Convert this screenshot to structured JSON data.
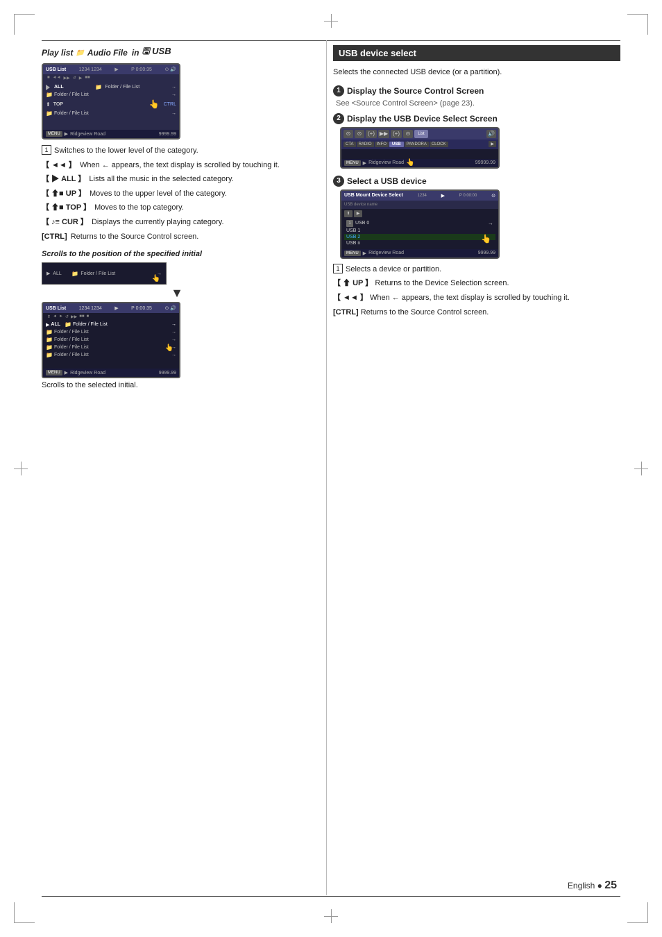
{
  "page": {
    "number": "25",
    "language": "English"
  },
  "left_column": {
    "playlist_header": "Play list",
    "icon_music": "♪",
    "icon_folder": "📁",
    "location": "Audio File in USB",
    "screen1": {
      "topbar_left": "USB List",
      "topbar_right": "1234 1234",
      "topbar_time": "P 0:00:35",
      "row1": "ALL",
      "row2": "Folder / File List",
      "row3": "Folder / File List",
      "row4": "TOP",
      "row5": "Folder / File List",
      "bottombar": "MENU  ▶  Ridgeview Road  9999.99"
    },
    "desc_items": [
      {
        "num": "1",
        "text": "Switches to the lower level of the category."
      },
      {
        "bracket": "[ ◄◄ ]",
        "text": "When ← appears, the text display is scrolled by touching it."
      },
      {
        "bracket": "[ ▶ ALL ]",
        "text": "Lists all the music in the selected category."
      },
      {
        "bracket": "[ ⬆■ UP ]",
        "text": "Moves to the upper level of the category."
      },
      {
        "bracket": "[ ⬆■ TOP ]",
        "text": "Moves to the top category."
      },
      {
        "bracket": "[ ♪≡ CUR ]",
        "text": "Displays the currently playing category."
      },
      {
        "bracket": "[CTRL]",
        "text": "Returns to the Source Control screen."
      }
    ],
    "scrolls_section": {
      "title": "Scrolls to the position of the specified initial",
      "small_screen_text": "▶  ALL      Folder / File List",
      "caption": "Scrolls to the selected initial."
    }
  },
  "right_column": {
    "section_title": "USB device select",
    "section_desc": "Selects the connected USB device (or a partition).",
    "steps": [
      {
        "num": "1",
        "title": "Display the Source Control Screen",
        "desc": "See <Source Control Screen> (page 23)."
      },
      {
        "num": "2",
        "title": "Display the USB Device Select Screen",
        "screen": {
          "buttons": [
            "⊙",
            "⊙",
            "(+)",
            "▶▶",
            "(+)",
            "⊙",
            "List"
          ],
          "row2_buttons": [
            "CTA",
            "RADIO",
            "INFO",
            "USB",
            "PANDORA",
            "CLOCK",
            "▶"
          ],
          "bottombar": "MENU  ▶  Ridgeview Road  99999.99"
        }
      },
      {
        "num": "3",
        "title": "Select a USB device",
        "screen": {
          "topbar": "USB Mount Device Select",
          "topbar2": "1234  1234",
          "topbar3": "P 0:00:00",
          "rows": [
            "USB device name",
            "USB 0",
            "USB 1",
            "USB 2",
            "USB n"
          ],
          "selected": "USB 2"
        },
        "desc_items": [
          {
            "num": "1",
            "text": "Selects a device or partition."
          },
          {
            "bracket": "[ ⬆ UP ]",
            "text": "Returns to the Device Selection screen."
          },
          {
            "bracket": "[ ◄◄ ]",
            "text": "When ← appears, the text display is scrolled by touching it."
          },
          {
            "bracket": "[CTRL]",
            "text": "Returns to the Source Control screen."
          }
        ]
      }
    ]
  }
}
